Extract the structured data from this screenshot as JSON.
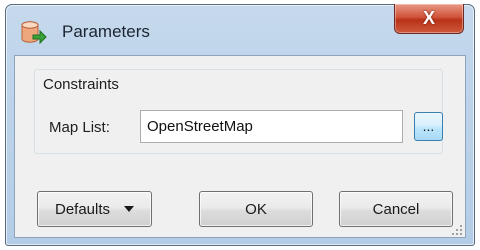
{
  "window": {
    "title": "Parameters",
    "close_glyph": "X",
    "icon": "database-arrow-icon"
  },
  "constraints": {
    "group_title": "Constraints",
    "map_list_label": "Map List:",
    "map_list_value": "OpenStreetMap",
    "browse_label": "..."
  },
  "buttons": {
    "defaults_label": "Defaults",
    "ok_label": "OK",
    "cancel_label": "Cancel"
  },
  "colors": {
    "title_bar": "#bcd3ea",
    "close_button": "#c7462b",
    "client_bg": "#f0f0f0",
    "browse_button": "#bee6fd"
  }
}
